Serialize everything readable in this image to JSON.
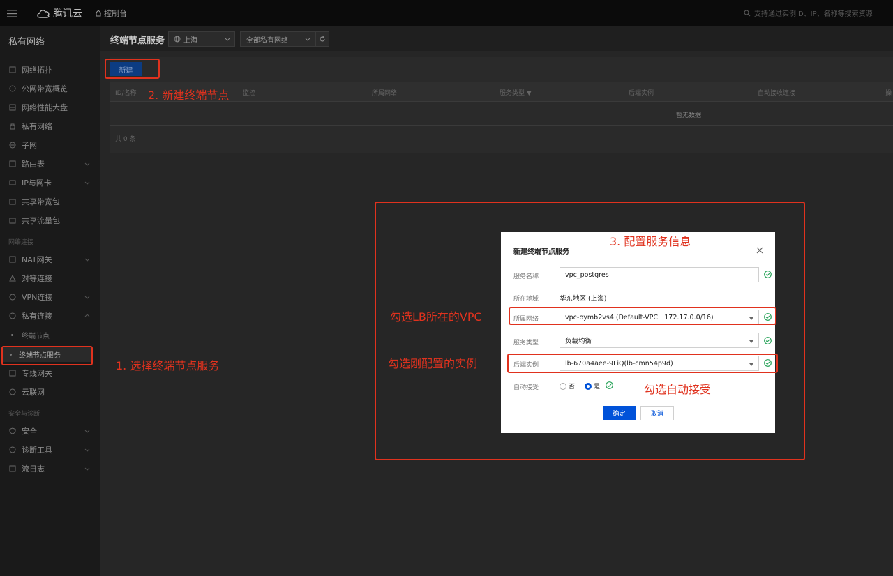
{
  "topbar": {
    "brand": "腾讯云",
    "console": "控制台",
    "search_placeholder": "支持通过实例ID、IP、名称等搜索资源"
  },
  "sidebar": {
    "title": "私有网络",
    "items": [
      {
        "label": "网络拓扑",
        "icon": "topology-icon"
      },
      {
        "label": "公网带宽概览",
        "icon": "bandwidth-icon"
      },
      {
        "label": "网络性能大盘",
        "icon": "dashboard-icon"
      },
      {
        "label": "私有网络",
        "icon": "vpc-icon"
      },
      {
        "label": "子网",
        "icon": "subnet-icon"
      },
      {
        "label": "路由表",
        "icon": "route-icon",
        "expandable": true
      },
      {
        "label": "IP与网卡",
        "icon": "nic-icon",
        "expandable": true
      },
      {
        "label": "共享带宽包",
        "icon": "package-icon"
      },
      {
        "label": "共享流量包",
        "icon": "traffic-icon"
      }
    ],
    "section_connect": "网络连接",
    "connect_items": [
      {
        "label": "NAT网关",
        "icon": "nat-icon",
        "expandable": true
      },
      {
        "label": "对等连接",
        "icon": "peering-icon"
      },
      {
        "label": "VPN连接",
        "icon": "vpn-icon",
        "expandable": true
      },
      {
        "label": "私有连接",
        "icon": "private-link-icon",
        "expandable": true
      }
    ],
    "sub_items": [
      {
        "label": "终端节点"
      },
      {
        "label": "终端节点服务",
        "active": true
      }
    ],
    "more_items": [
      {
        "label": "专线网关",
        "icon": "dc-gateway-icon"
      },
      {
        "label": "云联网",
        "icon": "ccn-icon"
      }
    ],
    "section_security": "安全与诊断",
    "security_items": [
      {
        "label": "安全",
        "icon": "shield-icon",
        "expandable": true
      },
      {
        "label": "诊断工具",
        "icon": "diagnose-icon",
        "expandable": true
      },
      {
        "label": "流日志",
        "icon": "log-icon",
        "expandable": true
      }
    ]
  },
  "main": {
    "title": "终端节点服务",
    "region": "上海",
    "vpc_filter": "全部私有网络",
    "new_button": "新建",
    "columns": [
      "ID/名称",
      "监控",
      "所属网络",
      "服务类型",
      "后端实例",
      "自动接收连接",
      "操"
    ],
    "empty_text": "暂无数据",
    "total": "共 0 条"
  },
  "dialog": {
    "title": "新建终端节点服务",
    "fields": {
      "service_name": {
        "label": "服务名称",
        "value": "vpc_postgres"
      },
      "region": {
        "label": "所在地域",
        "value": "华东地区 (上海)"
      },
      "vpc": {
        "label": "所属网络",
        "value": "vpc-oymb2vs4 (Default-VPC | 172.17.0.0/16)"
      },
      "service_type": {
        "label": "服务类型",
        "value": "负载均衡"
      },
      "backend": {
        "label": "后端实例",
        "value": "lb-670a4aee-9LiQ(lb-cmn54p9d)"
      },
      "auto_accept": {
        "label": "自动接受",
        "option_no": "否",
        "option_yes": "是",
        "selected": "是"
      }
    },
    "confirm": "确定",
    "cancel": "取消"
  },
  "annotations": {
    "step1": "1. 选择终端节点服务",
    "step2": "2. 新建终端节点",
    "step3": "3. 配置服务信息",
    "vpc_hint": "勾选LB所在的VPC",
    "backend_hint": "勾选刚配置的实例",
    "auto_hint": "勾选自动接受"
  },
  "colors": {
    "annotation_red": "#e0321e",
    "primary_blue": "#0052d9",
    "success_green": "#29a35a"
  }
}
